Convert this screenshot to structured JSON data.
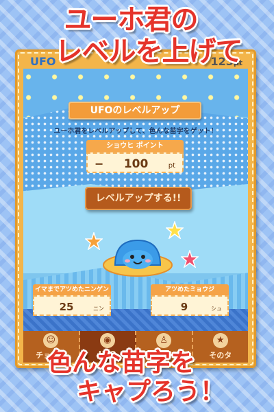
{
  "headline": {
    "line1": "ユーホ君の",
    "line2": "レベルを上げて"
  },
  "status": {
    "title": "UFO",
    "points": "123",
    "points_unit": "pt"
  },
  "levelup": {
    "title": "UFOのレベルアップ",
    "subtitle": "ユーホ君をレベルアップして、色んな苗字をゲット！",
    "point_label": "ショウヒ ポイント",
    "cost_sign": "−",
    "cost_value": "100",
    "cost_unit": "pt",
    "button_label": "レベルアップする!!"
  },
  "stats": [
    {
      "label": "イマまでアツめたニンゲン",
      "value": "25",
      "unit": "ニン"
    },
    {
      "label": "アツめたミョウジ",
      "value": "9",
      "unit": "シュ"
    }
  ],
  "tabs": [
    {
      "label": "チョウサ",
      "icon": "person-icon"
    },
    {
      "label": "UFO",
      "icon": "ufo-icon",
      "active": true
    },
    {
      "label": "ニンゲン",
      "icon": "human-icon"
    },
    {
      "label": "そのタ",
      "icon": "star-icon"
    }
  ],
  "footer": {
    "line1": "色んな苗字を",
    "line2": "キャプろう！"
  },
  "colors": {
    "headline_red": "#e5332a",
    "frame_orange": "#f3b54a",
    "title_blue": "#2f6fc0",
    "tab_brown": "#b5611f"
  }
}
